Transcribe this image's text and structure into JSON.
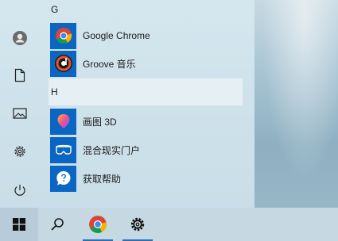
{
  "start_menu": {
    "sections": [
      {
        "letter": "G",
        "apps": [
          {
            "label": "Google Chrome",
            "icon": "chrome-icon"
          },
          {
            "label": "Groove 音乐",
            "icon": "groove-music-icon"
          }
        ]
      },
      {
        "letter": "H",
        "apps": [
          {
            "label": "画图 3D",
            "icon": "paint-3d-icon"
          },
          {
            "label": "混合现实门户",
            "icon": "mixed-reality-portal-icon"
          },
          {
            "label": "获取帮助",
            "icon": "get-help-icon"
          }
        ]
      }
    ],
    "rail": [
      "user-avatar-icon",
      "documents-icon",
      "pictures-icon",
      "settings-icon",
      "power-icon"
    ]
  },
  "taskbar": {
    "items": [
      "windows-start-icon",
      "search-icon",
      "chrome-icon",
      "settings-icon"
    ]
  },
  "colors": {
    "tile_blue": "#0a66c2",
    "accent": "#2a6fb7"
  }
}
